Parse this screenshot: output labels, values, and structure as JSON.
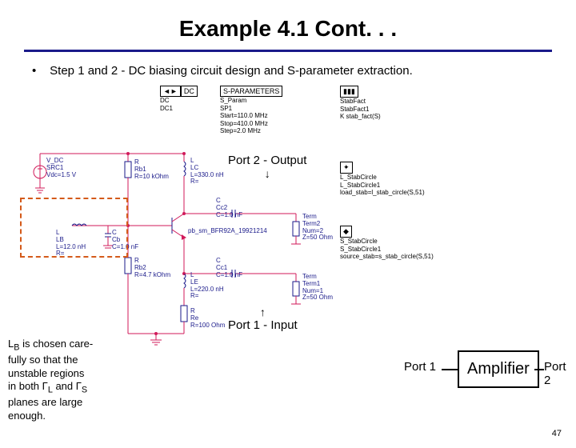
{
  "title": "Example 4.1 Cont. . .",
  "bullet": "Step 1 and 2 - DC biasing circuit design and S-parameter extraction.",
  "sim": {
    "dc": {
      "hdr1": "◄►",
      "hdr2": "DC",
      "lines": [
        "DC",
        "DC1"
      ]
    },
    "sparam": {
      "hdr": "S-PARAMETERS",
      "lines": [
        "S_Param",
        "SP1",
        "Start=110.0 MHz",
        "Stop=410.0 MHz",
        "Step=2.0 MHz"
      ]
    },
    "stabfact": {
      "hdr": "▮▮▮",
      "lines": [
        "StabFact",
        "StabFact1",
        "K stab_fact(S)"
      ]
    },
    "lscircle": {
      "hdr": "✦",
      "lines": [
        "L_StabCircle",
        "L_StabCircle1",
        "load_stab=l_stab_circle(S,51)"
      ]
    },
    "sscircle": {
      "hdr": "◆",
      "lines": [
        "S_StabCircle",
        "S_StabCircle1",
        "source_stab=s_stab_circle(S,51)"
      ]
    }
  },
  "components": {
    "vdc": [
      "V_DC",
      "SRC1",
      "Vdc=1.5 V"
    ],
    "rb1": [
      "R",
      "Rb1",
      "R=10 kOhm"
    ],
    "lc": [
      "L",
      "LC",
      "L=330.0 nH",
      "R="
    ],
    "lb": [
      "L",
      "LB",
      "L=12.0 nH",
      "R="
    ],
    "cb": [
      "C",
      "Cb",
      "C=1.0 nF"
    ],
    "cc2": [
      "C",
      "Cc2",
      "C=1.0 nF"
    ],
    "term2": [
      "Term",
      "Term2",
      "Num=2",
      "Z=50 Ohm"
    ],
    "rb2": [
      "R",
      "Rb2",
      "R=4.7 kOhm"
    ],
    "bjt": [
      "pb_sm_BFR92A_19921214"
    ],
    "le": [
      "L",
      "LE",
      "L=220.0 nH",
      "R="
    ],
    "cc1": [
      "C",
      "Cc1",
      "C=1.0 nF"
    ],
    "term1": [
      "Term",
      "Term1",
      "Num=1",
      "Z=50 Ohm"
    ],
    "re": [
      "R",
      "Re",
      "R=100 Ohm"
    ]
  },
  "ports": {
    "p2out": "Port 2 - Output",
    "p1in": "Port 1 - Input"
  },
  "note": "L_B is chosen carefully so that the unstable regions in both Γ_L and Γ_S planes are large enough.",
  "note_plain_prefix": "L",
  "note_plain_1": " is chosen care-\nfully so that the\nunstable regions\nin both Γ",
  "note_plain_2": " and Γ",
  "note_plain_3": "\nplanes are large\nenough.",
  "note_sub_b": "B",
  "note_sub_l": "L",
  "note_sub_s": "S",
  "amp": {
    "label": "Amplifier",
    "p1": "Port 1",
    "p2": "Port 2"
  },
  "page": "47"
}
